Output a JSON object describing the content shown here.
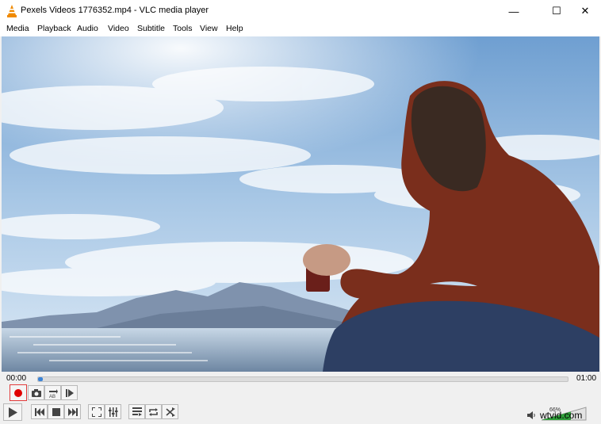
{
  "window": {
    "title": "Pexels Videos 1776352.mp4 - VLC media player",
    "minimize_label": "—",
    "maximize_label": "☐",
    "close_label": "✕"
  },
  "menu": [
    "Media",
    "Playback",
    "Audio",
    "Video",
    "Subtitle",
    "Tools",
    "View",
    "Help"
  ],
  "player": {
    "elapsed": "00:00",
    "duration": "01:00",
    "progress_fraction": 0.005,
    "volume_percent": "66%",
    "volume_level": 0.66
  },
  "controls": {
    "row1": [
      "record-icon",
      "snapshot-icon",
      "loop-ab-icon",
      "frame-step-icon"
    ],
    "row2": [
      "play-icon",
      "previous-icon",
      "stop-icon",
      "next-icon",
      "fullscreen-icon",
      "extended-settings-icon",
      "playlist-icon",
      "loop-icon",
      "shuffle-icon"
    ]
  },
  "watermark": "wtvid.com",
  "colors": {
    "accent": "#3c84d6",
    "record": "#e00000"
  }
}
